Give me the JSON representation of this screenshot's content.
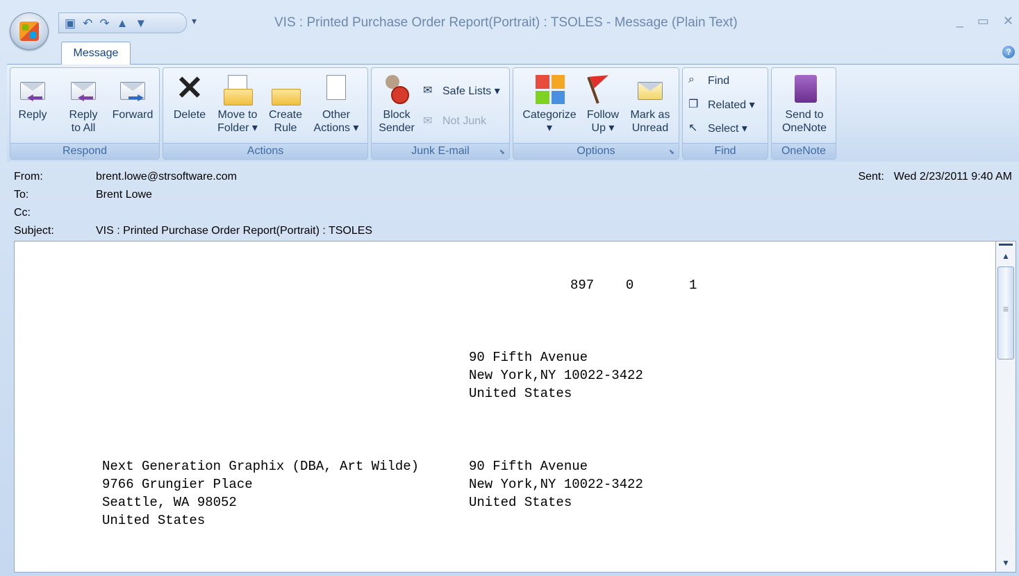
{
  "window": {
    "title": "VIS : Printed Purchase Order Report(Portrait) : TSOLES - Message (Plain Text)",
    "minimize": "_",
    "maximize": "▭",
    "close": "✕"
  },
  "quick_access": {
    "save_icon": "save-icon",
    "undo_icon": "undo-icon",
    "redo_icon": "redo-icon",
    "prev_icon": "up-arrow-icon",
    "next_icon": "down-arrow-icon",
    "more": "▾"
  },
  "tabs": [
    {
      "label": "Message",
      "active": true
    }
  ],
  "help": "?",
  "ribbon": {
    "respond": {
      "label": "Respond",
      "reply": "Reply",
      "reply_all_1": "Reply",
      "reply_all_2": "to All",
      "forward": "Forward"
    },
    "actions": {
      "label": "Actions",
      "delete": "Delete",
      "move_1": "Move to",
      "move_2": "Folder ▾",
      "create_1": "Create",
      "create_2": "Rule",
      "other_1": "Other",
      "other_2": "Actions ▾"
    },
    "junk": {
      "label": "Junk E-mail",
      "block_1": "Block",
      "block_2": "Sender",
      "safe_lists": "Safe Lists ▾",
      "not_junk": "Not Junk"
    },
    "options": {
      "label": "Options",
      "categorize": "Categorize",
      "categorize_2": "▾",
      "follow_1": "Follow",
      "follow_2": "Up ▾",
      "mark_1": "Mark as",
      "mark_2": "Unread"
    },
    "find": {
      "label": "Find",
      "find": "Find",
      "related": "Related ▾",
      "select": "Select ▾"
    },
    "onenote": {
      "label": "OneNote",
      "send_1": "Send to",
      "send_2": "OneNote"
    }
  },
  "header": {
    "from_label": "From:",
    "from": "brent.lowe@strsoftware.com",
    "to_label": "To:",
    "to": "Brent Lowe",
    "cc_label": "Cc:",
    "cc": "",
    "subject_label": "Subject:",
    "subject": "VIS : Printed Purchase Order Report(Portrait) : TSOLES",
    "sent_label": "Sent:",
    "sent": "Wed 2/23/2011 9:40 AM"
  },
  "body": {
    "numbers": "897    0       1",
    "ship_to": "90 Fifth Avenue\nNew York,NY 10022-3422\nUnited States",
    "vendor": "Next Generation Graphix (DBA, Art Wilde)\n9766 Grungier Place\nSeattle, WA 98052\nUnited States",
    "bill_to": "90 Fifth Avenue\nNew York,NY 10022-3422\nUnited States"
  }
}
